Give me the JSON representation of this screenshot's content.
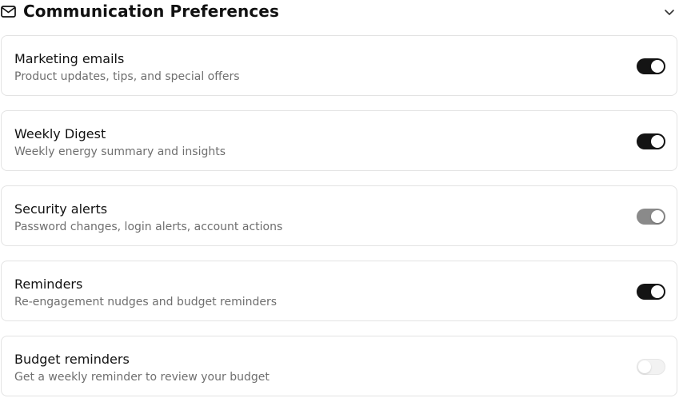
{
  "section": {
    "title": "Communication Preferences",
    "icon": "mail-icon",
    "collapse_icon": "chevron-down-icon"
  },
  "preferences": [
    {
      "title": "Marketing emails",
      "description": "Product updates, tips, and special offers",
      "enabled": true,
      "disabled": false
    },
    {
      "title": "Weekly Digest",
      "description": "Weekly energy summary and insights",
      "enabled": true,
      "disabled": false
    },
    {
      "title": "Security alerts",
      "description": "Password changes, login alerts, account actions",
      "enabled": true,
      "disabled": true
    },
    {
      "title": "Reminders",
      "description": "Re-engagement nudges and budget reminders",
      "enabled": true,
      "disabled": false
    },
    {
      "title": "Budget reminders",
      "description": "Get a weekly reminder to review your budget",
      "enabled": false,
      "disabled": true
    }
  ],
  "colors": {
    "toggle_on": "#141414",
    "toggle_locked": "#8a8a8a",
    "toggle_off": "#f2f2f2",
    "description_text": "#6f6f6f",
    "card_border": "#e3e3e3"
  }
}
